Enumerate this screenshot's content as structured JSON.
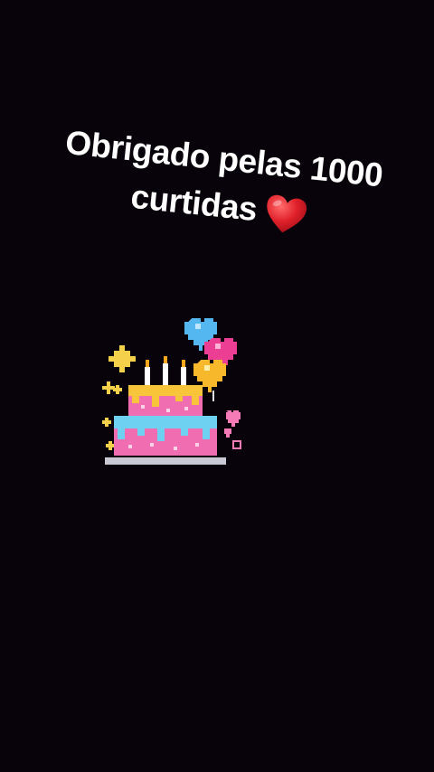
{
  "caption": {
    "line1": "Obrigado pelas 1000",
    "line2": "curtidas"
  },
  "icons": {
    "heart": "red-heart-icon",
    "sticker": "pixel-birthday-cake-icon"
  },
  "colors": {
    "background": "#08030a",
    "text": "#ffffff",
    "heart": "#e0202a"
  }
}
